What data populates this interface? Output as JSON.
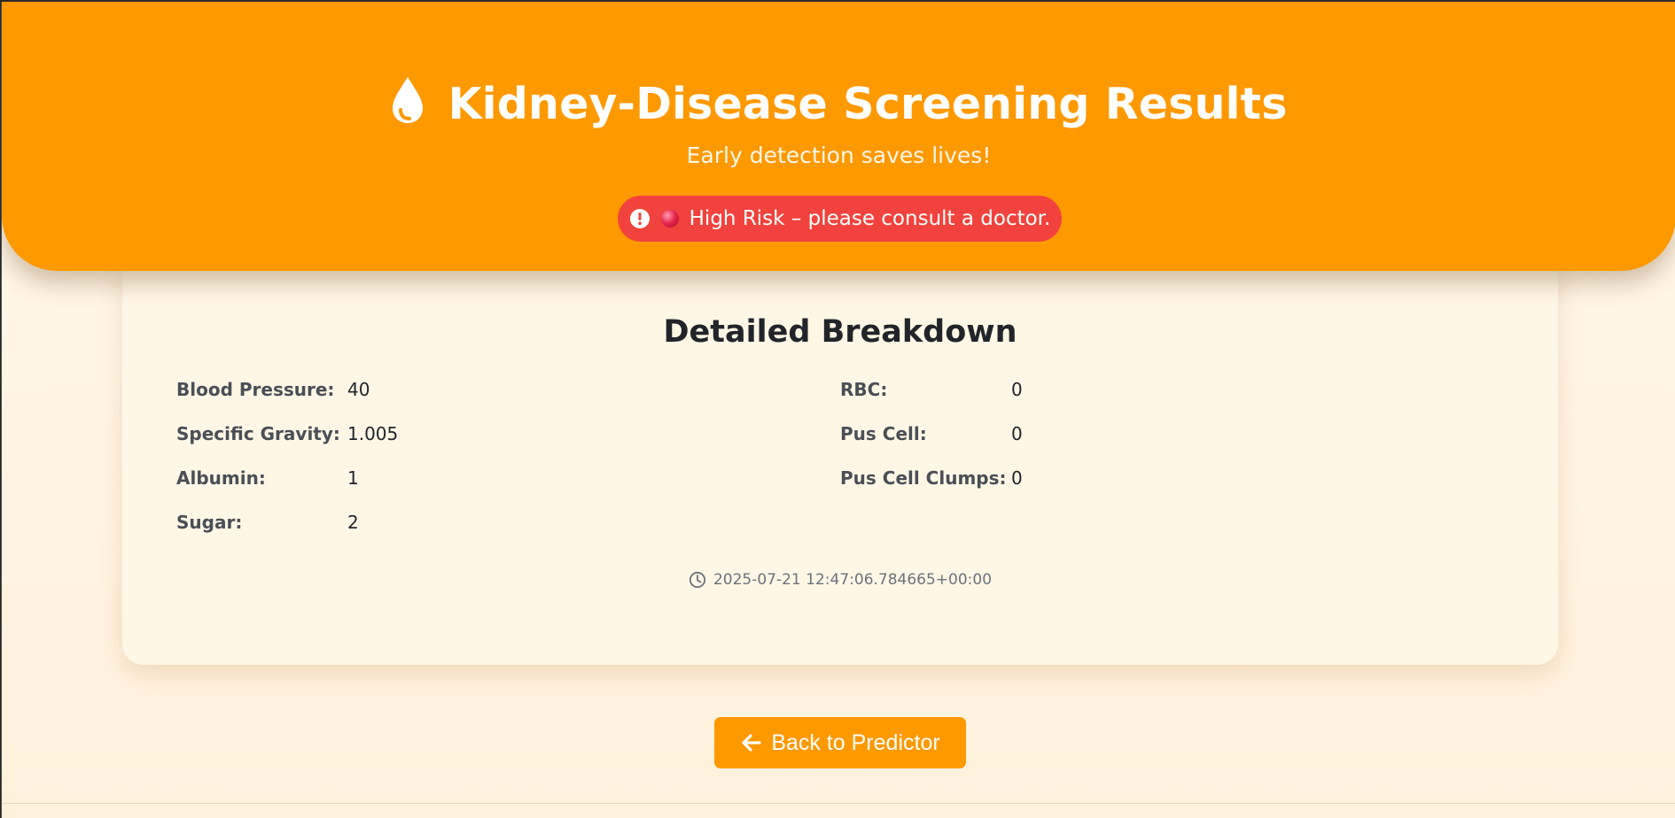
{
  "hero": {
    "title": "Kidney-Disease Screening Results",
    "subtitle": "Early detection saves lives!",
    "risk_message": "High Risk – please consult a doctor.",
    "icon": "water-drop-icon",
    "risk_icon": "exclamation-circle-icon",
    "risk_indicator": "red-circle-emoji"
  },
  "breakdown": {
    "heading": "Detailed Breakdown",
    "left_metrics": [
      {
        "label": "Blood Pressure:",
        "value": "40"
      },
      {
        "label": "Specific Gravity:",
        "value": "1.005"
      },
      {
        "label": "Albumin:",
        "value": "1"
      },
      {
        "label": "Sugar:",
        "value": "2"
      }
    ],
    "right_metrics": [
      {
        "label": "RBC:",
        "value": "0"
      },
      {
        "label": "Pus Cell:",
        "value": "0"
      },
      {
        "label": "Pus Cell Clumps:",
        "value": "0"
      }
    ],
    "timestamp": "2025-07-21 12:47:06.784665+00:00",
    "timestamp_icon": "clock-icon"
  },
  "actions": {
    "back_label": "Back to Predictor",
    "back_icon": "arrow-left-icon"
  },
  "colors": {
    "primary_orange": "#ff9900",
    "risk_red": "#f2423d",
    "card_background": "#fff7e6",
    "heading_text": "#212529"
  }
}
